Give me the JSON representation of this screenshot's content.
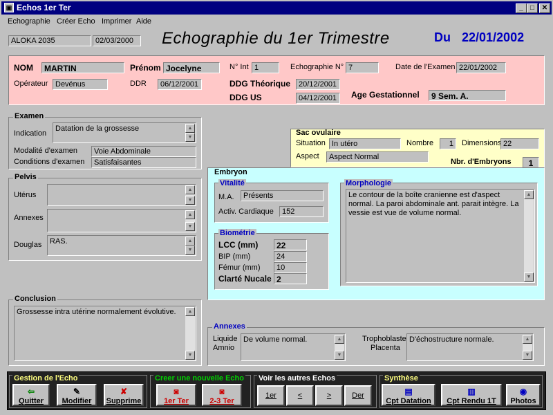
{
  "window": {
    "title": "Echos 1er Ter"
  },
  "menu": [
    "Echographie",
    "Créer Echo",
    "Imprimer",
    "Aide"
  ],
  "header": {
    "device": "ALOKA 2035",
    "device_date": "02/03/2000",
    "title": "Echographie du 1er Trimestre",
    "du_label": "Du",
    "date": "22/01/2002"
  },
  "patient": {
    "nom_label": "NOM",
    "nom": "MARTIN",
    "prenom_label": "Prénom",
    "prenom": "Jocelyne",
    "nint_label": "N° Int",
    "nint": "1",
    "echo_num_label": "Echographie N°",
    "echo_num": "7",
    "date_exam_label": "Date de l'Examen",
    "date_exam": "22/01/2002",
    "operateur_label": "Opérateur",
    "operateur": "Devénus",
    "ddr_label": "DDR",
    "ddr": "06/12/2001",
    "ddg_theo_label": "DDG Théorique",
    "ddg_theo": "20/12/2001",
    "ddg_us_label": "DDG US",
    "ddg_us": "04/12/2001",
    "age_label": "Age Gestationnel",
    "age": "9 Sem. A."
  },
  "examen": {
    "title": "Examen",
    "indication_label": "Indication",
    "indication": "Datation de la grossesse",
    "modalite_label": "Modalité d'examen",
    "modalite": "Voie Abdominale",
    "conditions_label": "Conditions d'examen",
    "conditions": "Satisfaisantes"
  },
  "pelvis": {
    "title": "Pelvis",
    "uterus_label": "Utérus",
    "uterus": "",
    "annexes_label": "Annexes",
    "annexes": "",
    "douglas_label": "Douglas",
    "douglas": "RAS."
  },
  "conclusion": {
    "title": "Conclusion",
    "text": "Grossesse intra utérine normalement évolutive."
  },
  "sac": {
    "title": "Sac ovulaire",
    "situation_label": "Situation",
    "situation": "In utéro",
    "nombre_label": "Nombre",
    "nombre": "1",
    "dimensions_label": "Dimensions",
    "dimensions": "22",
    "aspect_label": "Aspect",
    "aspect": "Aspect Normal",
    "nbr_emb_label": "Nbr. d'Embryons",
    "nbr_emb": "1"
  },
  "embryon": {
    "title": "Embryon",
    "vitalite": {
      "title": "Vitalité",
      "ma_label": "M.A.",
      "ma": "Présents",
      "cardiaque_label": "Activ. Cardiaque",
      "cardiaque": "152"
    },
    "biometrie": {
      "title": "Biométrie",
      "lcc_label": "LCC (mm)",
      "lcc": "22",
      "bip_label": "BIP (mm)",
      "bip": "24",
      "femur_label": "Fémur (mm)",
      "femur": "10",
      "clarte_label": "Clarté Nucale",
      "clarte": "2"
    },
    "morphologie": {
      "title": "Morphologie",
      "text": "Le contour de la boîte cranienne est d'aspect normal. La paroi abdominale ant. parait intègre. La vessie est vue de volume normal."
    }
  },
  "annexes": {
    "title": "Annexes",
    "liquide_label": "Liquide",
    "amnio_label": "Amnio",
    "liquide": "De volume normal.",
    "tropho_label": "Trophoblaste",
    "placenta_label": "Placenta",
    "tropho": "D'échostructure normale."
  },
  "toolbar": {
    "gestion_title": "Gestion de l'Echo",
    "quitter": "Quitter",
    "modifier": "Modifier",
    "supprime": "Supprime",
    "creer_title": "Creer une nouvelle Echo",
    "t1": "1er Ter",
    "t23": "2-3 Ter",
    "voir_title": "Voir les autres Echos",
    "first": "1er",
    "prev": "<",
    "next": ">",
    "last": "Der",
    "synthese_title": "Synthèse",
    "cpt_datation": "Cpt Datation",
    "cpt_rendu": "Cpt Rendu 1T",
    "photos": "Photos"
  },
  "colors": {
    "title_blue": "#0000c0",
    "green_title": "#00d000",
    "yellow_title": "#ffff80",
    "creer_red": "#cc0000"
  }
}
